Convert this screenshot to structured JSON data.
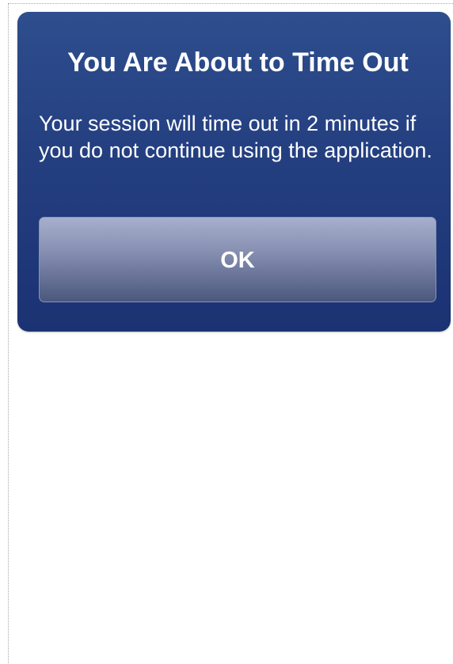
{
  "dialog": {
    "title": "You Are About to Time Out",
    "message": "Your session will time out in 2 minutes if you do not continue using the application.",
    "ok_label": "OK",
    "background_color": "#243f80",
    "button_color": "#7d86a8"
  }
}
